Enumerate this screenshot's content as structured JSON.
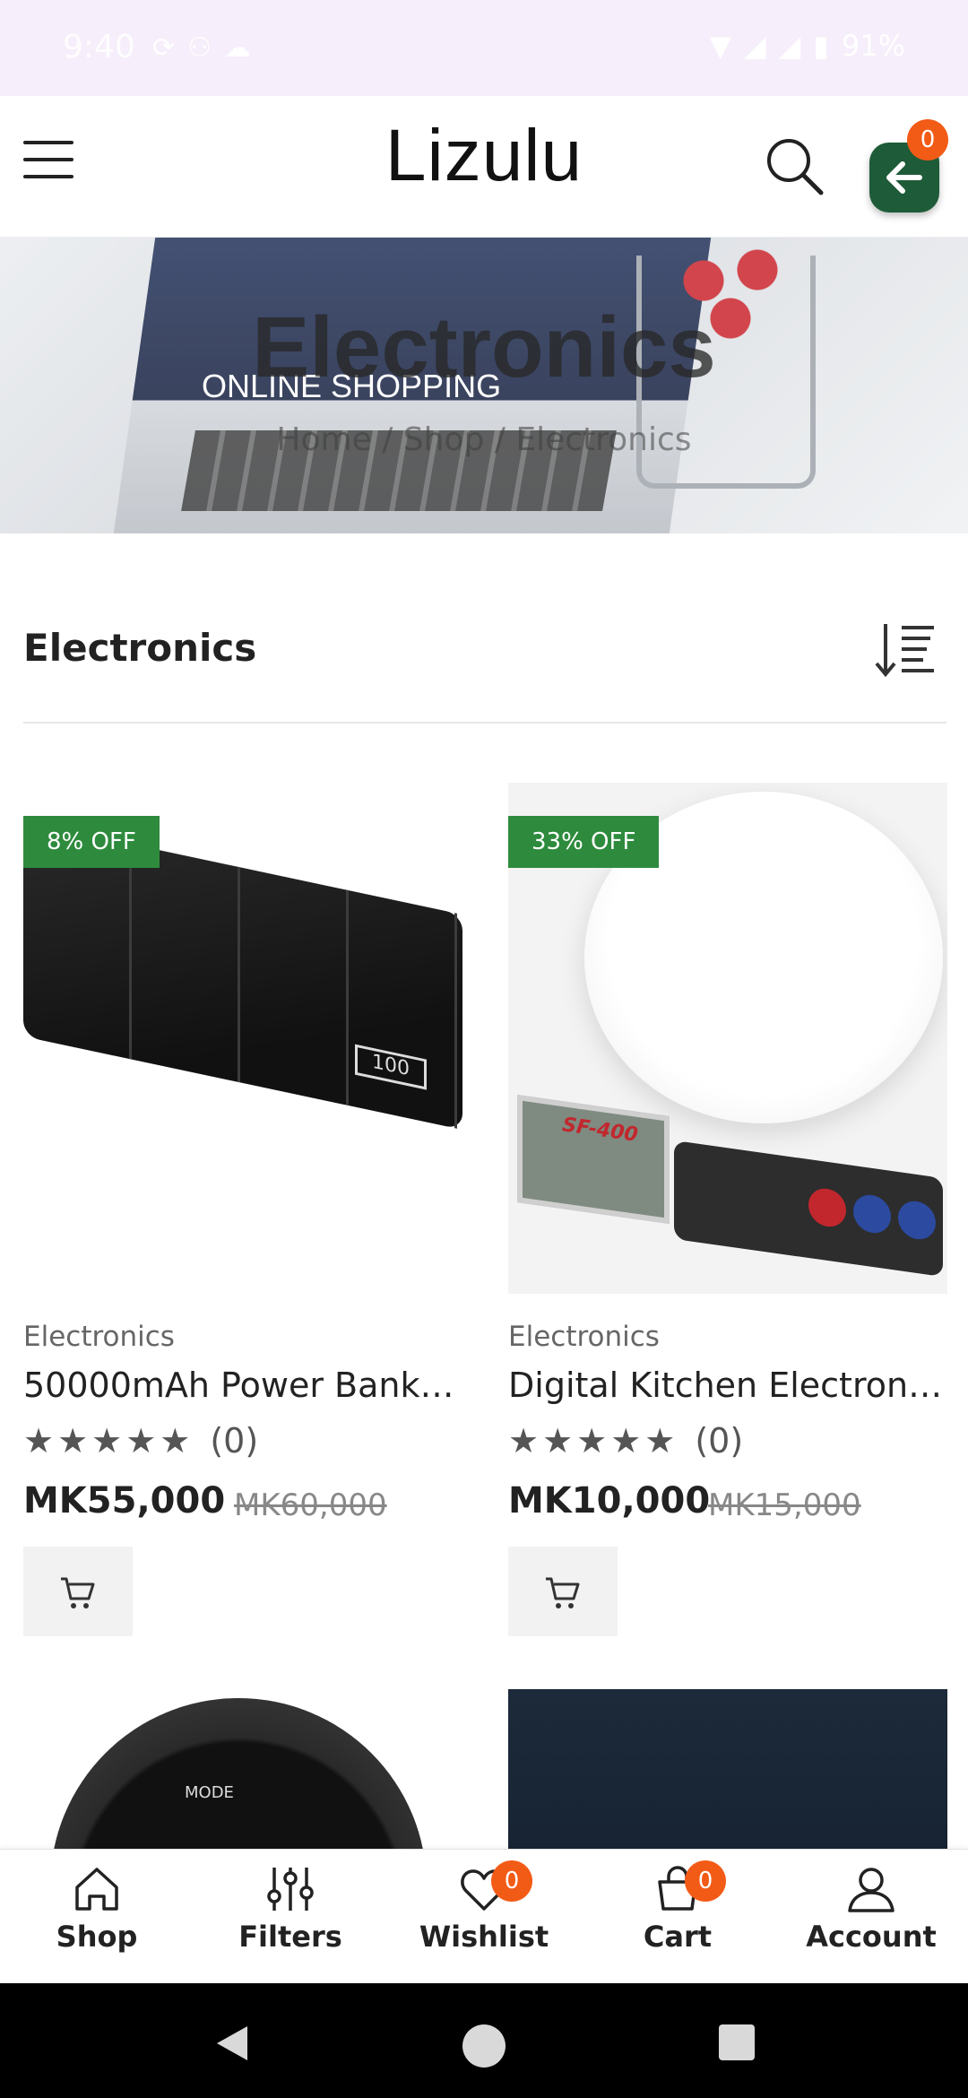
{
  "status_bar": {
    "time": "9:40",
    "battery": "91%"
  },
  "header": {
    "logo": "Lizulu",
    "cart_count": "0"
  },
  "banner": {
    "title": "Electronics",
    "breadcrumb": [
      "Home",
      "Shop",
      "Electronics"
    ],
    "breadcrumb_sep": "/",
    "image_text": "ONLINE SHOPPING"
  },
  "section": {
    "title": "Electronics"
  },
  "products": [
    {
      "badge": "8% OFF",
      "category": "Electronics",
      "name": "50000mAh Power Bank ...",
      "stars": "★★★★★",
      "rating_count": "(0)",
      "price": "MK55,000",
      "old_price": "MK60,000",
      "image_text": "100"
    },
    {
      "badge": "33% OFF",
      "category": "Electronics",
      "name": "Digital Kitchen Electroni...",
      "stars": "★★★★★",
      "rating_count": "(0)",
      "price": "MK10,000",
      "old_price": "MK15,000",
      "image_text": "SF-400"
    },
    {
      "image_text": "MODE"
    }
  ],
  "bottom_nav": {
    "shop": "Shop",
    "filters": "Filters",
    "wishlist": "Wishlist",
    "wishlist_count": "0",
    "cart": "Cart",
    "cart_count": "0",
    "account": "Account"
  },
  "colors": {
    "accent_green": "#2e8b3d",
    "badge_orange": "#f25b16",
    "fab_green": "#1e5b38"
  }
}
